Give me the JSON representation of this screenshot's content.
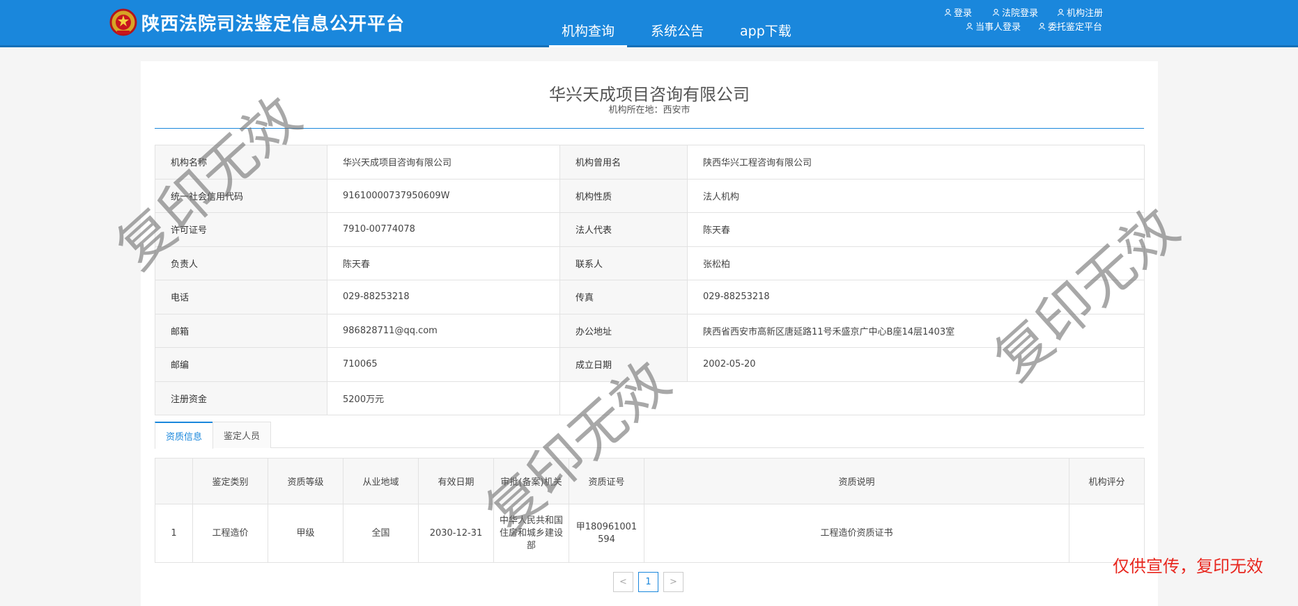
{
  "header": {
    "title": "陕西法院司法鉴定信息公开平台",
    "nav": [
      "机构查询",
      "系统公告",
      "app下载"
    ],
    "links_row1": [
      "登录",
      "法院登录",
      "机构注册"
    ],
    "links_row2": [
      "当事人登录",
      "委托鉴定平台"
    ]
  },
  "org": {
    "name": "华兴天成项目咨询有限公司",
    "location": "机构所在地：西安市"
  },
  "info": {
    "name_label": "机构名称",
    "name_value": "华兴天成项目咨询有限公司",
    "former_label": "机构曾用名",
    "former_value": "陕西华兴工程咨询有限公司",
    "credit_label": "统一社会信用代码",
    "credit_value": "91610000737950609W",
    "nature_label": "机构性质",
    "nature_value": "法人机构",
    "license_label": "许可证号",
    "license_value": "7910-00774078",
    "legal_label": "法人代表",
    "legal_value": "陈天春",
    "leader_label": "负责人",
    "leader_value": "陈天春",
    "contact_label": "联系人",
    "contact_value": "张松柏",
    "phone_label": "电话",
    "phone_value": "029-88253218",
    "fax_label": "传真",
    "fax_value": "029-88253218",
    "email_label": "邮箱",
    "email_value": "986828711@qq.com",
    "address_label": "办公地址",
    "address_value": "陕西省西安市高新区唐延路11号禾盛京广中心B座14层1403室",
    "zip_label": "邮编",
    "zip_value": "710065",
    "founded_label": "成立日期",
    "founded_value": "2002-05-20",
    "capital_label": "注册资金",
    "capital_value": "5200万元"
  },
  "tabs": [
    "资质信息",
    "鉴定人员"
  ],
  "qual_table": {
    "headers": [
      "",
      "鉴定类别",
      "资质等级",
      "从业地域",
      "有效日期",
      "审批(备案)机关",
      "资质证号",
      "资质说明",
      "机构评分"
    ],
    "rows": [
      {
        "no": "1",
        "category": "工程造价",
        "grade": "甲级",
        "region": "全国",
        "valid": "2030-12-31",
        "authority": "中华人民共和国住房和城乡建设部",
        "cert": "甲180961001594",
        "desc": "工程造价资质证书",
        "score": ""
      }
    ]
  },
  "pager": {
    "prev": "<",
    "current": "1",
    "next": ">"
  },
  "watermark": "复印无效",
  "promo": "仅供宣传，复印无效",
  "colors": {
    "primary": "#1a87dc",
    "promo": "#e8261e"
  }
}
